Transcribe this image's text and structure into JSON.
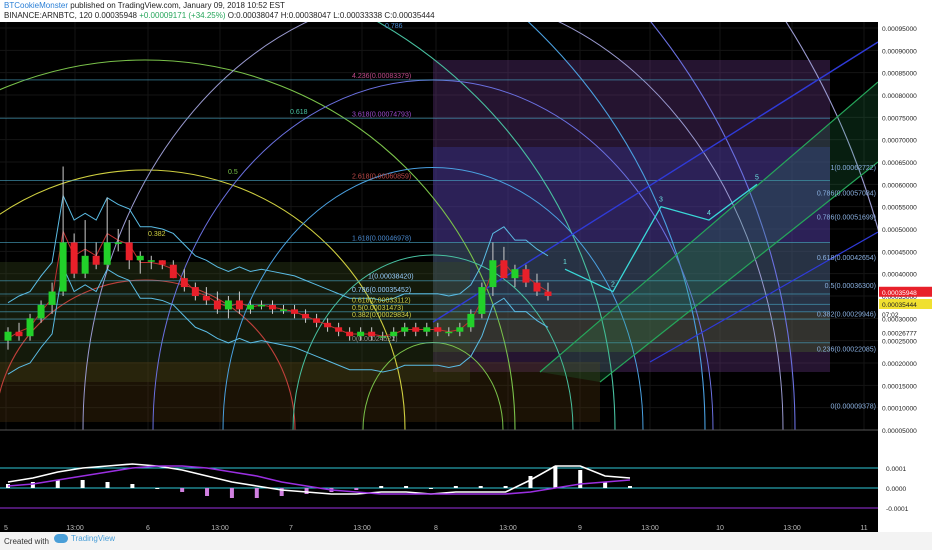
{
  "header": {
    "author": "BTCookieMonster",
    "published_text": "published on TradingView.com, January 09, 2018 10:52 EST",
    "symbol": "BINANCE:ARNBTC, 120",
    "last": "0.00035948",
    "change": "+0.00009171 (+34.25%)",
    "open": "O:0.00038047",
    "high": "H:0.00038047",
    "low": "L:0.00033338",
    "close": "C:0.00035444"
  },
  "footer": {
    "created_with": "Created with",
    "brand": "TradingView"
  },
  "colors": {
    "up": "#22d02a",
    "down": "#e8202a",
    "bg": "#000000",
    "bollinger": "#5bbce4",
    "fib_channel": "#26a65b",
    "fib_channel_blue": "#2f3ad8",
    "macd": "#ffffff",
    "signal": "#9a2fe0",
    "histogram": "#2ec7d6"
  },
  "chart_data": [
    {
      "type": "candlestick",
      "title": "BINANCE:ARNBTC, 120",
      "x_tick_labels": [
        "5",
        "13:00",
        "6",
        "13:00",
        "7",
        "13:00",
        "8",
        "13:00",
        "9",
        "13:00",
        "10",
        "13:00",
        "11"
      ],
      "y_tick_labels": [
        "0.00095000",
        "0.00090000",
        "0.00085000",
        "0.00080000",
        "0.00075000",
        "0.00070000",
        "0.00065000",
        "0.00060000",
        "0.00055000",
        "0.00050000",
        "0.00045000",
        "0.00040000",
        "0.00035000",
        "0.00030000",
        "0.00025000",
        "0.00020000",
        "0.00015000",
        "0.00010000",
        "0.00005000"
      ],
      "ylim": [
        5e-05,
        0.00095
      ],
      "price_labels": {
        "last": "0.00035948",
        "close": "0.00035444",
        "countdown": "07:02",
        "marker": "0.00026777"
      },
      "candles": [
        [
          0.00025,
          0.00028,
          0.00023,
          0.00027
        ],
        [
          0.00027,
          0.00029,
          0.00025,
          0.00026
        ],
        [
          0.00026,
          0.00031,
          0.00025,
          0.0003
        ],
        [
          0.0003,
          0.00034,
          0.00029,
          0.00033
        ],
        [
          0.00033,
          0.00038,
          0.00031,
          0.00036
        ],
        [
          0.00036,
          0.00064,
          0.00035,
          0.00047
        ],
        [
          0.00047,
          0.00049,
          0.00039,
          0.0004
        ],
        [
          0.0004,
          0.00052,
          0.00039,
          0.00044
        ],
        [
          0.00044,
          0.00047,
          0.00041,
          0.00042
        ],
        [
          0.00042,
          0.00057,
          0.00041,
          0.00047
        ],
        [
          0.00047,
          0.0005,
          0.00045,
          0.00047
        ],
        [
          0.00047,
          0.00052,
          0.00041,
          0.00043
        ],
        [
          0.00043,
          0.00045,
          0.0004,
          0.00044
        ],
        [
          0.00043,
          0.00044,
          0.00041,
          0.00043
        ],
        [
          0.00043,
          0.00043,
          0.00041,
          0.00042
        ],
        [
          0.00042,
          0.00043,
          0.00039,
          0.00039
        ],
        [
          0.00039,
          0.00041,
          0.00036,
          0.00037
        ],
        [
          0.00037,
          0.00038,
          0.00034,
          0.00035
        ],
        [
          0.00035,
          0.00037,
          0.00033,
          0.00034
        ],
        [
          0.00034,
          0.00036,
          0.00031,
          0.00032
        ],
        [
          0.00032,
          0.00035,
          0.0003,
          0.00034
        ],
        [
          0.00034,
          0.00036,
          0.00031,
          0.00032
        ],
        [
          0.00032,
          0.00034,
          0.00031,
          0.00033
        ],
        [
          0.00033,
          0.00034,
          0.00032,
          0.00033
        ],
        [
          0.00033,
          0.00034,
          0.00031,
          0.00032
        ],
        [
          0.00032,
          0.00033,
          0.00031,
          0.00032
        ],
        [
          0.00032,
          0.00033,
          0.0003,
          0.00031
        ],
        [
          0.00031,
          0.00032,
          0.00029,
          0.0003
        ],
        [
          0.0003,
          0.00031,
          0.00028,
          0.00029
        ],
        [
          0.00029,
          0.0003,
          0.00027,
          0.00028
        ],
        [
          0.00028,
          0.00029,
          0.00026,
          0.00027
        ],
        [
          0.00027,
          0.00028,
          0.00025,
          0.00026
        ],
        [
          0.00026,
          0.00028,
          0.00025,
          0.00027
        ],
        [
          0.00027,
          0.00028,
          0.00025,
          0.00026
        ],
        [
          0.00026,
          0.00027,
          0.00025,
          0.00026
        ],
        [
          0.00026,
          0.00028,
          0.00025,
          0.00027
        ],
        [
          0.00027,
          0.00029,
          0.00026,
          0.00028
        ],
        [
          0.00028,
          0.00029,
          0.00026,
          0.00027
        ],
        [
          0.00027,
          0.00029,
          0.00026,
          0.00028
        ],
        [
          0.00028,
          0.00029,
          0.00026,
          0.00027
        ],
        [
          0.00027,
          0.00028,
          0.00026,
          0.00027
        ],
        [
          0.00027,
          0.00029,
          0.00026,
          0.00028
        ],
        [
          0.00028,
          0.00032,
          0.00027,
          0.00031
        ],
        [
          0.00031,
          0.00038,
          0.0003,
          0.00037
        ],
        [
          0.00037,
          0.00047,
          0.00035,
          0.00043
        ],
        [
          0.00043,
          0.00046,
          0.00039,
          0.00039
        ],
        [
          0.00039,
          0.00042,
          0.00037,
          0.00041
        ],
        [
          0.00041,
          0.00042,
          0.00037,
          0.00038
        ],
        [
          0.00038,
          0.0004,
          0.00035,
          0.00036
        ],
        [
          0.00036,
          0.00038,
          0.00034,
          0.00035
        ]
      ],
      "fib_retracement_labels": [
        "4.236(0.00083379)",
        "3.618(0.00074793)",
        "2.618(0.00060859)",
        "1.618(0.00046978)",
        "1(0.00038420)",
        "0.786(0.00035452)",
        "0.618(0.00033112)",
        "0.5(0.00031473)",
        "0.382(0.00029834)",
        "0(0.00024522)"
      ],
      "fib_channel_labels": [
        "1(0.00062722)",
        "0.786(0.00057084)",
        "0.786(0.00051699)",
        "0.618(0.00042654)",
        "0.5(0.00036300)",
        "0.382(0.00029946)",
        "0.236(0.00022085)",
        "0(0.00009378)"
      ],
      "fan_labels": [
        "0.786",
        "0.618",
        "0.5",
        "0.382"
      ],
      "projection_labels": [
        "1",
        "2",
        "3",
        "4",
        "5"
      ],
      "projection_points": [
        [
          0.00047,
          0.00041
        ],
        [
          0.0004,
          0.00036
        ],
        [
          0.00057,
          0.00055
        ],
        [
          0.0005,
          0.00052
        ],
        [
          0.00064,
          0.0006
        ]
      ]
    },
    {
      "type": "line",
      "title": "MACD",
      "y_tick_labels": [
        "0.0001",
        "0.0000",
        "-0.0001"
      ],
      "series": [
        {
          "values": [
            3e-05,
            5e-05,
            8e-05,
            0.0001,
            0.00011,
            0.00012,
            0.00011,
            9e-05,
            6e-05,
            3e-05,
            1e-05,
            -1e-05,
            -2e-05,
            -3e-05,
            -3e-05,
            -2e-05,
            -2e-05,
            -3e-05,
            -2e-05,
            -2e-05,
            -2e-05,
            4e-05,
            0.00011,
            0.00011,
            6e-05,
            5e-05
          ]
        },
        {
          "values": [
            1e-05,
            2e-05,
            4e-05,
            6e-05,
            8e-05,
            0.0001,
            0.00011,
            0.00011,
            0.0001,
            8e-05,
            6e-05,
            3e-05,
            1e-05,
            -1e-05,
            -2e-05,
            -3e-05,
            -3e-05,
            -3e-05,
            -3e-05,
            -3e-05,
            -3e-05,
            -2e-05,
            0.0,
            2e-05,
            3e-05,
            4e-05
          ]
        }
      ],
      "histogram": [
        2e-05,
        3e-05,
        4e-05,
        4e-05,
        3e-05,
        2e-05,
        0.0,
        -2e-05,
        -4e-05,
        -5e-05,
        -5e-05,
        -4e-05,
        -3e-05,
        -2e-05,
        -1e-05,
        1e-05,
        1e-05,
        0.0,
        1e-05,
        1e-05,
        1e-05,
        6e-05,
        0.00011,
        9e-05,
        3e-05,
        1e-05
      ]
    }
  ]
}
